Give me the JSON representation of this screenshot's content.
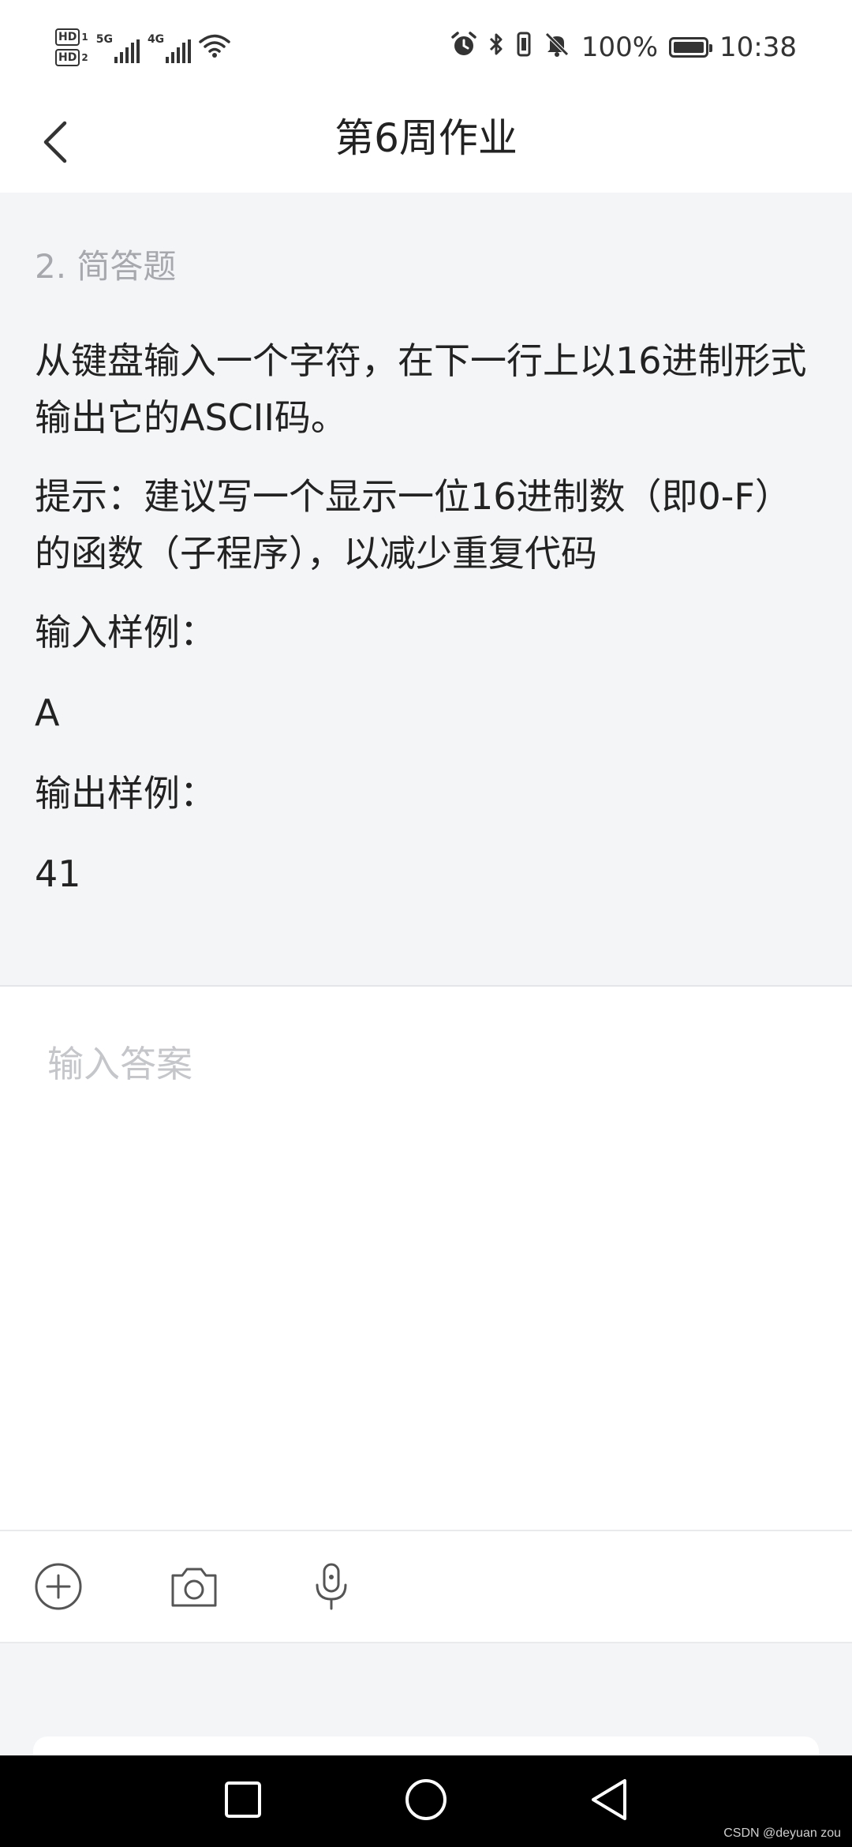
{
  "status_bar": {
    "hd1": "HD",
    "hd1_num": "1",
    "hd2": "HD",
    "hd2_num": "2",
    "net1": "5G",
    "net2": "4G",
    "battery_percent": "100%",
    "time": "10:38",
    "icons": [
      "wifi-icon",
      "alarm-icon",
      "bluetooth-icon",
      "vibrate-icon",
      "mute-bell-icon",
      "battery-icon"
    ]
  },
  "header": {
    "title": "第6周作业",
    "back_icon": "chevron-left-icon"
  },
  "question": {
    "type_label": "2. 简答题",
    "body": "从键盘输入一个字符，在下一行上以16进制形式输出它的ASCII码。",
    "hint": "提示：建议写一个显示一位16进制数（即0-F）的函数（子程序），以减少重复代码",
    "input_sample_label": "输入样例：",
    "input_sample": "A",
    "output_sample_label": "输出样例：",
    "output_sample": "41"
  },
  "answer": {
    "placeholder": "输入答案",
    "value": ""
  },
  "toolbar": {
    "icons": [
      "add-circle-icon",
      "camera-icon",
      "microphone-icon"
    ]
  },
  "navigation": {
    "icons": [
      "square-recent-icon",
      "circle-home-icon",
      "triangle-back-icon"
    ]
  },
  "watermark": "CSDN @deyuan zou",
  "colors": {
    "question_bg": "#f4f5f7",
    "muted_text": "#a6a8ad",
    "placeholder_text": "#c4c6ca",
    "nav_bg": "#000000"
  }
}
